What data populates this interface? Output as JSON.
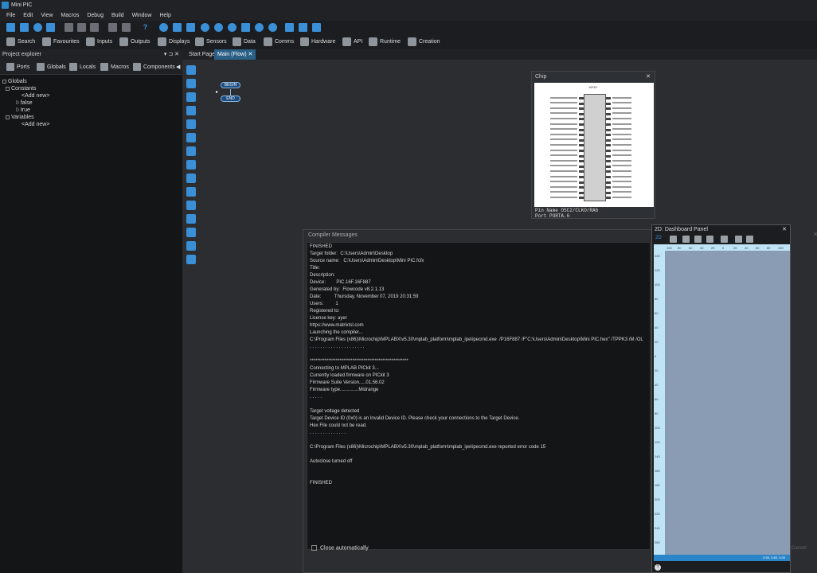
{
  "window": {
    "title": "Mini PIC"
  },
  "menu": [
    "File",
    "Edit",
    "View",
    "Macros",
    "Debug",
    "Build",
    "Window",
    "Help"
  ],
  "toolbar2": [
    "Search",
    "Favourites",
    "Inputs",
    "Outputs",
    "Displays",
    "Sensors",
    "Data",
    "Comms",
    "Hardware",
    "API",
    "Runtime",
    "Creation"
  ],
  "project_explorer": {
    "title": "Project explorer",
    "controls": "▾ ⊐ ✕",
    "tabs": [
      "Ports",
      "Globals",
      "Locals",
      "Macros",
      "Components"
    ],
    "tree": {
      "root": "Globals",
      "constants": "Constants",
      "add_new_1": "<Add new>",
      "false_item": "false",
      "true_item": "true",
      "variables": "Variables",
      "add_new_2": "<Add new>"
    }
  },
  "doc_tabs": [
    "Start Page",
    "Main (Flow)"
  ],
  "flowchart": {
    "begin": "BEGIN",
    "end": "END"
  },
  "chip": {
    "title": "Chip",
    "part": "16F87",
    "info_line1": "Pin Name  OSC2/CLKO/RA6",
    "info_line2": "Port      PORTA.6"
  },
  "compiler": {
    "title": "Compiler Messages",
    "lines": [
      "FINISHED",
      "Target folder:  C:\\Users\\Admin\\Desktop",
      "Source name:   C:\\Users\\Admin\\Desktop\\Mini PIC.fcfx",
      "Title:",
      "Description:",
      "Device:        PIC.16F.16F887",
      "Generated by:  Flowcode v8.2.1.13",
      "Date:          Thursday, November 07, 2019 20:31:59",
      "Users:         1",
      "Registered to:",
      "License key: ayer",
      "https://www.matrixtsl.com",
      "Launching the compiler...",
      "C:\\Program Files (x86)\\Microchip\\MPLABX\\v5.30\\mplab_platform\\mplab_ipe\\ipecmd.exe  /P16F887 /F\"C:\\Users\\Admin\\Desktop\\Mini PIC.hex\" /TPPK3 /M /OL",
      ". . . . . . . . . . . . . . . . . . . . .",
      "",
      "*****************************************************",
      "Connecting to MPLAB PICkit 3...",
      "Currently loaded firmware on PICkit 3",
      "Firmware Suite Version.....01.56.02",
      "Firmware type..............Midrange",
      ". . . . .",
      "",
      "Target voltage detected",
      "Target Device ID (0x0) is an Invalid Device ID. Please check your connections to the Target Device.",
      "Hex File could not be read.",
      ". . . . . . . . . . . . . .",
      "",
      "C:\\Program Files (x86)\\Microchip\\MPLABX\\v5.30\\mplab_platform\\mplab_ipe\\ipecmd.exe reported error code 15",
      "",
      "Autoclose turned off",
      "",
      "",
      "FINISHED"
    ],
    "close_auto": "Close automatically"
  },
  "dashboard": {
    "title": "2D: Dashboard Panel",
    "mode": "2D",
    "status": "0.50, 0.60, 0.00",
    "ruler_top": [
      "100",
      "80",
      "60",
      "40",
      "20",
      "0",
      "20",
      "40",
      "60",
      "80",
      "100"
    ],
    "ruler_left": [
      "140",
      "120",
      "100",
      "80",
      "60",
      "40",
      "20",
      "0",
      "20",
      "40",
      "60",
      "80",
      "100",
      "120",
      "140",
      "160",
      "180",
      "200",
      "220",
      "240",
      "260"
    ],
    "help": "?"
  },
  "right_strip": {
    "cancel": "Cancel"
  }
}
